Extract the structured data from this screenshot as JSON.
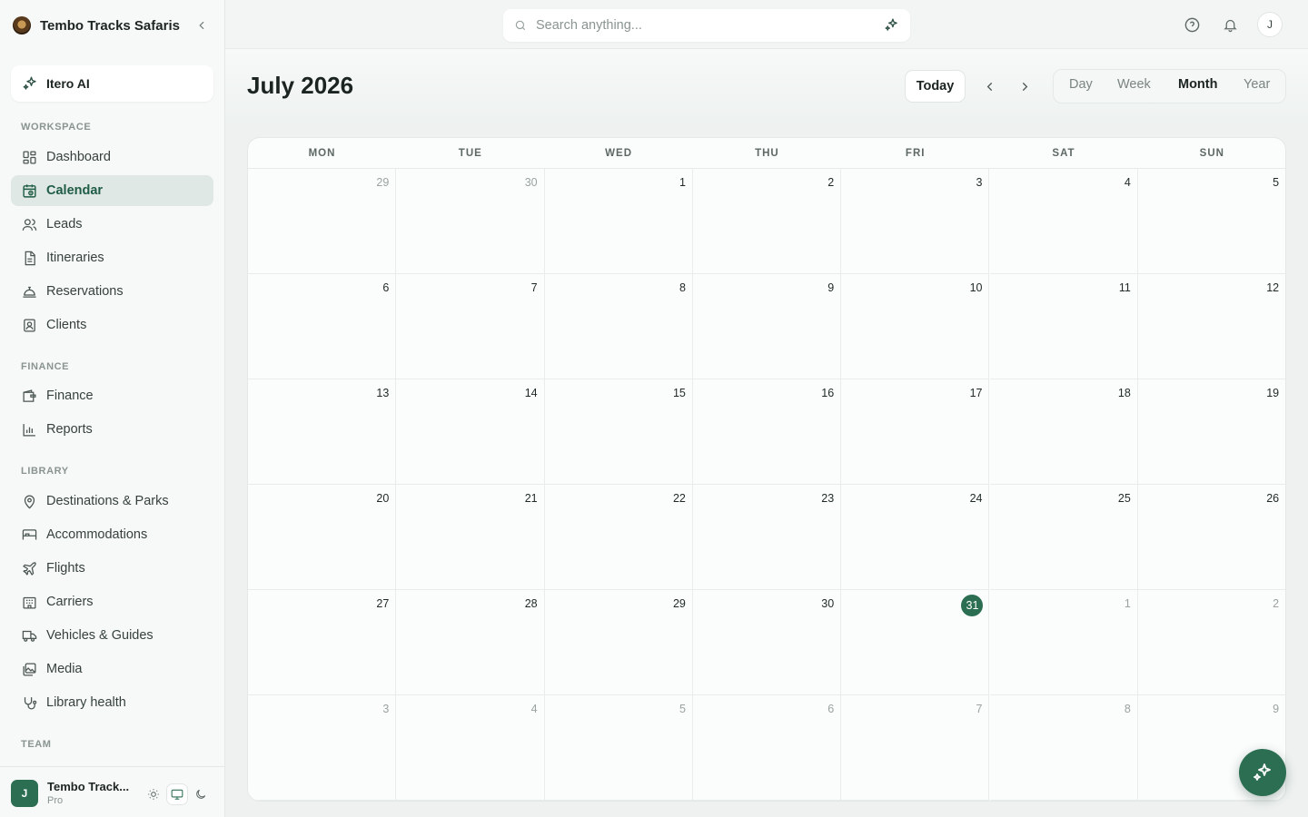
{
  "brand": {
    "name": "Tembo Tracks Safaris"
  },
  "ai": {
    "label": "Itero AI"
  },
  "sections": {
    "workspace": "WORKSPACE",
    "finance": "FINANCE",
    "library": "LIBRARY",
    "team": "TEAM"
  },
  "nav": {
    "dashboard": "Dashboard",
    "calendar": "Calendar",
    "leads": "Leads",
    "itineraries": "Itineraries",
    "reservations": "Reservations",
    "clients": "Clients",
    "finance": "Finance",
    "reports": "Reports",
    "destinations": "Destinations & Parks",
    "accommodations": "Accommodations",
    "flights": "Flights",
    "carriers": "Carriers",
    "vehicles": "Vehicles & Guides",
    "media": "Media",
    "library_health": "Library health"
  },
  "footer": {
    "avatar_initial": "J",
    "org_name": "Tembo Track...",
    "plan": "Pro"
  },
  "search": {
    "placeholder": "Search anything..."
  },
  "user": {
    "initial": "J"
  },
  "calendar": {
    "title": "July 2026",
    "today_label": "Today",
    "views": [
      "Day",
      "Week",
      "Month",
      "Year"
    ],
    "active_view": "Month",
    "weekdays": [
      "MON",
      "TUE",
      "WED",
      "THU",
      "FRI",
      "SAT",
      "SUN"
    ],
    "today_date": 31,
    "weeks": [
      [
        {
          "d": 29,
          "m": true
        },
        {
          "d": 30,
          "m": true
        },
        {
          "d": 1
        },
        {
          "d": 2
        },
        {
          "d": 3
        },
        {
          "d": 4
        },
        {
          "d": 5
        }
      ],
      [
        {
          "d": 6
        },
        {
          "d": 7
        },
        {
          "d": 8
        },
        {
          "d": 9
        },
        {
          "d": 10
        },
        {
          "d": 11
        },
        {
          "d": 12
        }
      ],
      [
        {
          "d": 13
        },
        {
          "d": 14
        },
        {
          "d": 15
        },
        {
          "d": 16
        },
        {
          "d": 17
        },
        {
          "d": 18
        },
        {
          "d": 19
        }
      ],
      [
        {
          "d": 20
        },
        {
          "d": 21
        },
        {
          "d": 22
        },
        {
          "d": 23
        },
        {
          "d": 24
        },
        {
          "d": 25
        },
        {
          "d": 26
        }
      ],
      [
        {
          "d": 27
        },
        {
          "d": 28
        },
        {
          "d": 29
        },
        {
          "d": 30
        },
        {
          "d": 31,
          "today": true
        },
        {
          "d": 1,
          "m": true
        },
        {
          "d": 2,
          "m": true
        }
      ],
      [
        {
          "d": 3,
          "m": true
        },
        {
          "d": 4,
          "m": true
        },
        {
          "d": 5,
          "m": true
        },
        {
          "d": 6,
          "m": true
        },
        {
          "d": 7,
          "m": true
        },
        {
          "d": 8,
          "m": true
        },
        {
          "d": 9,
          "m": true
        }
      ]
    ]
  },
  "colors": {
    "accent": "#2c6e52",
    "active_bg": "#dfe8e4"
  }
}
